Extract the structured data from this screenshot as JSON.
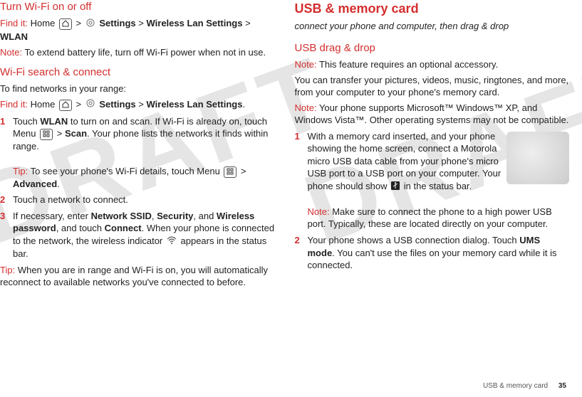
{
  "watermark": "DRAFT",
  "left": {
    "h_wifi_toggle": "Turn Wi-Fi on or off",
    "findit": "Find it:",
    "findit_path1_pre": " Home ",
    "findit_path1_mid": " > ",
    "findit_settings": "Settings",
    "findit_path1_post": " > ",
    "findit_wlan_settings": "Wireless Lan Settings",
    "findit_wlan": "WLAN",
    "note_label": "Note:",
    "note1": " To extend battery life, turn off Wi-Fi power when not in use.",
    "h_wifi_search": "Wi-Fi search & connect",
    "p_find": "To find networks in your range:",
    "findit_path2_tail": "Wireless Lan Settings",
    "li1_a": "Touch ",
    "li1_wlan": "WLAN",
    "li1_b": " to turn on and scan. If Wi-Fi is already on, touch Menu ",
    "li1_c": " > ",
    "li1_scan": "Scan",
    "li1_d": ". Your phone lists the networks it finds within range.",
    "tip_label": "Tip:",
    "tip1_a": " To see your phone's Wi-Fi details, touch Menu ",
    "tip1_b": " > ",
    "tip1_adv": "Advanced",
    "tip1_c": ".",
    "li2": "Touch a network to connect.",
    "li3_a": "If necessary, enter ",
    "li3_ssid": "Network SSID",
    "li3_b": ", ",
    "li3_sec": "Security",
    "li3_c": ", and ",
    "li3_pwd": "Wireless password",
    "li3_d": ", and touch ",
    "li3_conn": "Connect",
    "li3_e": ". When your phone is connected to the network, the wireless indicator ",
    "li3_f": " appears in the status bar.",
    "tip2": " When you are in range and Wi-Fi is on, you will automatically reconnect to available networks you've connected to before."
  },
  "right": {
    "h_usb": "USB & memory card",
    "subtitle": "connect your phone and computer, then drag & drop",
    "h_drag": "USB drag & drop",
    "note_label": "Note:",
    "note1": " This feature requires an optional accessory.",
    "p_transfer": "You can transfer your pictures, videos, music, ringtones, and more, from your computer to your phone's memory card.",
    "note2": " Your phone supports Microsoft™ Windows™ XP, and Windows Vista™. Other operating systems may not be compatible.",
    "li1_a": "With a memory card inserted, and your phone showing the home screen, connect a Motorola micro USB data cable from your phone's micro USB port to a USB port on your computer. Your phone should show ",
    "li1_b": " in the status bar.",
    "li1_note": " Make sure to connect the phone to a high power USB port. Typically, these are located directly on your computer.",
    "li2_a": "Your phone shows a USB connection dialog. Touch ",
    "li2_ums": "UMS mode",
    "li2_b": ". You can't use the files on your memory card while it is connected."
  },
  "footer": {
    "section": "USB & memory card",
    "page": "35"
  }
}
